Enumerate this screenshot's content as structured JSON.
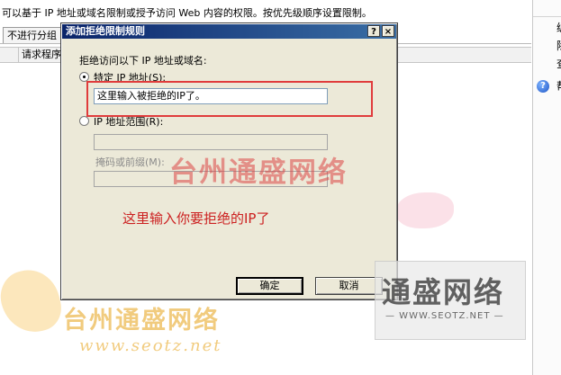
{
  "background": {
    "description": "可以基于 IP 地址或域名限制或授予访问 Web 内容的权限。按优先级顺序设置限制。",
    "tab_label": "不进行分组",
    "column_header": "请求程序",
    "right_panel_chars": [
      "编",
      "除",
      "查",
      "帮"
    ]
  },
  "dialog": {
    "title": "添加拒绝限制规则",
    "help_button": "?",
    "close_button": "×",
    "section_label": "拒绝访问以下 IP 地址或域名:",
    "specific_ip_label": "特定 IP 地址(S):",
    "specific_ip_value": "这里输入被拒绝的IP了。",
    "ip_range_label": "IP 地址范围(R):",
    "mask_label": "掩码或前缀(M):",
    "ok_button": "确定",
    "cancel_button": "取消"
  },
  "annotation": {
    "text": "这里输入你要拒绝的IP了",
    "color": "#cc2020"
  },
  "watermarks": {
    "big_text": "台州通盛网络",
    "small_text": "台州通盛网络",
    "url": "www.seotz.net",
    "logo_text": "通盛网络",
    "logo_url": "— WWW.SEOTZ.NET —"
  }
}
